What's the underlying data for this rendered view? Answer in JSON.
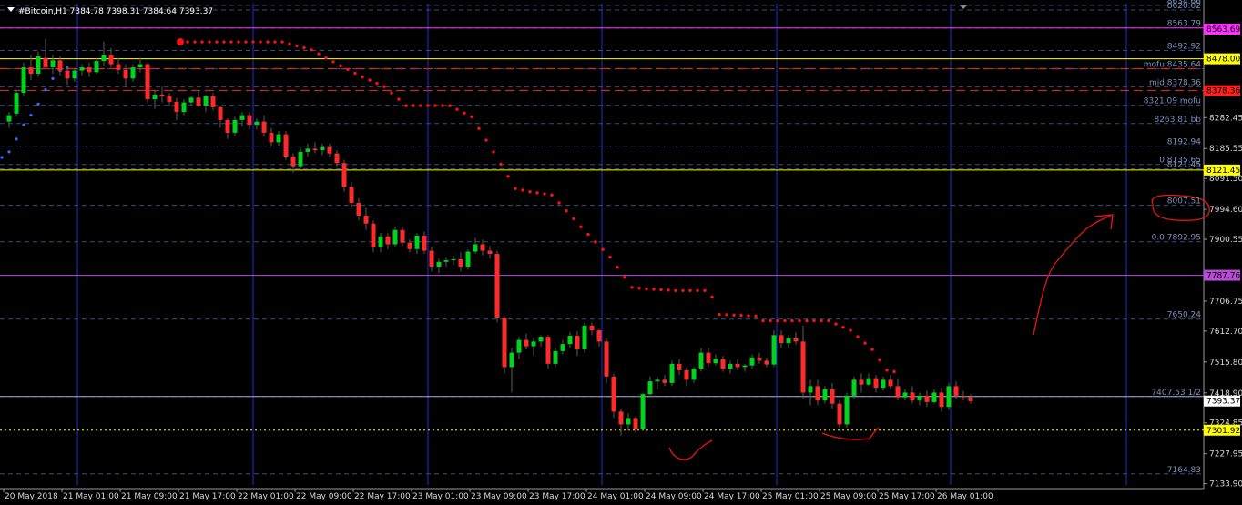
{
  "title": "#Bitcoin,H1  7384.78 7398.31 7384.64 7393.37",
  "colors": {
    "background": "#000000",
    "grid": "#2c3a66",
    "period_sep": "#1e2fd0",
    "bull": "#00d41c",
    "bear": "#ff2a2a",
    "wick": "#5c5c5c",
    "ma_red": "#ff1010",
    "ma_blue": "#3a6cff",
    "annot": "#e81515",
    "yellow": "#ffff00",
    "magenta": "#ff33ff",
    "violet": "#b84dd6",
    "level_text": "#7a8fb8",
    "tick_text": "#d8d8d8"
  },
  "chart_data": {
    "type": "candlestick",
    "symbol": "#Bitcoin",
    "timeframe": "H1",
    "last_bar": {
      "open": 7384.78,
      "high": 7398.31,
      "low": 7384.64,
      "close": 7393.37
    },
    "ylim": [
      7130,
      8640
    ],
    "y_ticks": [
      "8282.45",
      "8185.55",
      "8091.50",
      "7994.60",
      "7900.55",
      "7706.75",
      "7612.70",
      "7515.80",
      "7418.90",
      "7324.85",
      "7227.95",
      "7133.90"
    ],
    "x_labels": [
      "20 May 2018",
      "21 May 01:00",
      "21 May 09:00",
      "21 May 17:00",
      "22 May 01:00",
      "22 May 09:00",
      "22 May 17:00",
      "23 May 01:00",
      "23 May 09:00",
      "23 May 17:00",
      "24 May 01:00",
      "24 May 09:00",
      "24 May 17:00",
      "25 May 01:00",
      "25 May 09:00",
      "25 May 17:00",
      "26 May 01:00"
    ],
    "levels": [
      {
        "label": "8634.66",
        "value": 8634.66
      },
      {
        "label": "8620.02",
        "value": 8620.02
      },
      {
        "label": "8563.79",
        "value": 8563.79
      },
      {
        "label": "8492.92",
        "value": 8492.92
      },
      {
        "label": "mofu 8435.64",
        "value": 8435.64
      },
      {
        "label": "mid 8378.36",
        "value": 8378.36
      },
      {
        "label": "8321.09 mofu",
        "value": 8321.09
      },
      {
        "label": "8263.81  bb",
        "value": 8263.81
      },
      {
        "label": "8192.94",
        "value": 8192.94
      },
      {
        "label": "0 8135.65",
        "value": 8135.65
      },
      {
        "label": "8121.45",
        "value": 8121.45
      },
      {
        "label": "8007.51",
        "value": 8007.51
      },
      {
        "label": "0.0  7892.95",
        "value": 7892.95
      },
      {
        "label": "7650.24",
        "value": 7650.24
      },
      {
        "label": "7407.53 1/2",
        "value": 7407.53
      },
      {
        "label": "7164.83",
        "value": 7164.83
      }
    ],
    "price_boxes": [
      {
        "text": "8563.69",
        "value": 8560,
        "bg": "#ff33ff",
        "fg": "#000000"
      },
      {
        "text": "8478.00",
        "value": 8467,
        "bg": "#ffff00",
        "fg": "#000000"
      },
      {
        "text": "8378.36",
        "value": 8367,
        "bg": "#ff2222",
        "fg": "#000000"
      },
      {
        "text": "8121.45",
        "value": 8118,
        "bg": "#ffff00",
        "fg": "#000000"
      },
      {
        "text": "7787.76",
        "value": 7787.76,
        "bg": "#b84dd6",
        "fg": "#000000"
      },
      {
        "text": "7393.37",
        "value": 7393.37,
        "bg": "#ffffff",
        "fg": "#000000"
      },
      {
        "text": "7301.92",
        "value": 7301.92,
        "bg": "#ffff00",
        "fg": "#000000"
      }
    ],
    "hlines": [
      {
        "value": 8563.79,
        "color": "#ff33ff",
        "style": "solid"
      },
      {
        "value": 8467,
        "color": "#ffff00",
        "style": "solid"
      },
      {
        "value": 8435.64,
        "color": "#ff2222",
        "style": "dash"
      },
      {
        "value": 8367,
        "color": "#ff2222",
        "style": "dash"
      },
      {
        "value": 8118,
        "color": "#ffff00",
        "style": "solid"
      },
      {
        "value": 7787.76,
        "color": "#b84dd6",
        "style": "solid"
      },
      {
        "value": 7407.53,
        "color": "#9db0d8",
        "style": "solid"
      },
      {
        "value": 7301.92,
        "color": "#ffff00",
        "style": "dot"
      }
    ],
    "candles": [
      [
        8270,
        8300,
        8250,
        8290
      ],
      [
        8295,
        8370,
        8285,
        8360
      ],
      [
        8360,
        8455,
        8350,
        8440
      ],
      [
        8440,
        8480,
        8400,
        8420
      ],
      [
        8420,
        8490,
        8410,
        8475
      ],
      [
        8470,
        8530,
        8455,
        8440
      ],
      [
        8440,
        8480,
        8420,
        8462
      ],
      [
        8462,
        8475,
        8415,
        8430
      ],
      [
        8430,
        8445,
        8385,
        8405
      ],
      [
        8405,
        8440,
        8395,
        8430
      ],
      [
        8430,
        8450,
        8415,
        8440
      ],
      [
        8440,
        8455,
        8410,
        8425
      ],
      [
        8425,
        8470,
        8420,
        8460
      ],
      [
        8460,
        8520,
        8445,
        8480
      ],
      [
        8480,
        8500,
        8440,
        8450
      ],
      [
        8450,
        8470,
        8420,
        8432
      ],
      [
        8432,
        8450,
        8380,
        8405
      ],
      [
        8405,
        8450,
        8395,
        8440
      ],
      [
        8440,
        8470,
        8425,
        8450
      ],
      [
        8450,
        8455,
        8330,
        8340
      ],
      [
        8340,
        8370,
        8310,
        8355
      ],
      [
        8355,
        8380,
        8330,
        8350
      ],
      [
        8350,
        8360,
        8320,
        8332
      ],
      [
        8332,
        8345,
        8275,
        8300
      ],
      [
        8300,
        8340,
        8290,
        8330
      ],
      [
        8330,
        8350,
        8320,
        8345
      ],
      [
        8345,
        8370,
        8315,
        8320
      ],
      [
        8320,
        8355,
        8300,
        8350
      ],
      [
        8350,
        8360,
        8305,
        8315
      ],
      [
        8315,
        8320,
        8250,
        8275
      ],
      [
        8275,
        8280,
        8215,
        8235
      ],
      [
        8235,
        8285,
        8225,
        8275
      ],
      [
        8275,
        8300,
        8255,
        8290
      ],
      [
        8290,
        8300,
        8245,
        8260
      ],
      [
        8260,
        8280,
        8245,
        8270
      ],
      [
        8270,
        8290,
        8225,
        8235
      ],
      [
        8235,
        8250,
        8195,
        8205
      ],
      [
        8205,
        8240,
        8195,
        8230
      ],
      [
        8230,
        8240,
        8150,
        8160
      ],
      [
        8160,
        8170,
        8110,
        8130
      ],
      [
        8130,
        8190,
        8120,
        8175
      ],
      [
        8175,
        8200,
        8160,
        8185
      ],
      [
        8185,
        8205,
        8170,
        8180
      ],
      [
        8180,
        8200,
        8165,
        8190
      ],
      [
        8190,
        8200,
        8160,
        8170
      ],
      [
        8170,
        8180,
        8130,
        8140
      ],
      [
        8140,
        8150,
        8050,
        8065
      ],
      [
        8065,
        8080,
        8000,
        8015
      ],
      [
        8015,
        8030,
        7960,
        7975
      ],
      [
        7975,
        8000,
        7930,
        7950
      ],
      [
        7950,
        7960,
        7860,
        7875
      ],
      [
        7875,
        7920,
        7860,
        7910
      ],
      [
        7910,
        7920,
        7870,
        7885
      ],
      [
        7885,
        7940,
        7875,
        7930
      ],
      [
        7930,
        7940,
        7880,
        7890
      ],
      [
        7890,
        7900,
        7860,
        7870
      ],
      [
        7870,
        7920,
        7855,
        7912
      ],
      [
        7912,
        7925,
        7855,
        7865
      ],
      [
        7865,
        7875,
        7800,
        7815
      ],
      [
        7815,
        7840,
        7795,
        7830
      ],
      [
        7830,
        7845,
        7815,
        7835
      ],
      [
        7835,
        7850,
        7820,
        7838
      ],
      [
        7838,
        7860,
        7800,
        7815
      ],
      [
        7815,
        7870,
        7805,
        7862
      ],
      [
        7862,
        7905,
        7855,
        7885
      ],
      [
        7885,
        7900,
        7850,
        7865
      ],
      [
        7865,
        7880,
        7840,
        7855
      ],
      [
        7855,
        7865,
        7640,
        7655
      ],
      [
        7655,
        7660,
        7480,
        7500
      ],
      [
        7500,
        7560,
        7420,
        7545
      ],
      [
        7545,
        7595,
        7525,
        7585
      ],
      [
        7585,
        7605,
        7555,
        7565
      ],
      [
        7565,
        7590,
        7535,
        7580
      ],
      [
        7580,
        7600,
        7565,
        7595
      ],
      [
        7595,
        7600,
        7495,
        7510
      ],
      [
        7510,
        7560,
        7500,
        7550
      ],
      [
        7550,
        7585,
        7540,
        7572
      ],
      [
        7572,
        7610,
        7560,
        7598
      ],
      [
        7598,
        7612,
        7535,
        7555
      ],
      [
        7555,
        7640,
        7545,
        7630
      ],
      [
        7630,
        7640,
        7600,
        7615
      ],
      [
        7615,
        7620,
        7565,
        7580
      ],
      [
        7580,
        7590,
        7450,
        7470
      ],
      [
        7470,
        7480,
        7340,
        7360
      ],
      [
        7360,
        7370,
        7285,
        7320
      ],
      [
        7320,
        7355,
        7300,
        7340
      ],
      [
        7340,
        7345,
        7295,
        7305
      ],
      [
        7305,
        7420,
        7300,
        7415
      ],
      [
        7415,
        7470,
        7405,
        7455
      ],
      [
        7455,
        7470,
        7430,
        7460
      ],
      [
        7460,
        7475,
        7440,
        7450
      ],
      [
        7450,
        7520,
        7440,
        7510
      ],
      [
        7510,
        7525,
        7475,
        7490
      ],
      [
        7490,
        7500,
        7440,
        7460
      ],
      [
        7460,
        7500,
        7450,
        7495
      ],
      [
        7495,
        7560,
        7485,
        7545
      ],
      [
        7545,
        7560,
        7500,
        7512
      ],
      [
        7512,
        7540,
        7505,
        7525
      ],
      [
        7525,
        7535,
        7485,
        7495
      ],
      [
        7495,
        7520,
        7480,
        7510
      ],
      [
        7510,
        7525,
        7490,
        7500
      ],
      [
        7500,
        7510,
        7485,
        7505
      ],
      [
        7505,
        7540,
        7495,
        7530
      ],
      [
        7530,
        7545,
        7510,
        7520
      ],
      [
        7520,
        7530,
        7500,
        7508
      ],
      [
        7508,
        7615,
        7500,
        7600
      ],
      [
        7600,
        7615,
        7560,
        7575
      ],
      [
        7575,
        7600,
        7560,
        7590
      ],
      [
        7590,
        7610,
        7570,
        7580
      ],
      [
        7580,
        7630,
        7400,
        7420
      ],
      [
        7420,
        7460,
        7380,
        7440
      ],
      [
        7440,
        7460,
        7380,
        7395
      ],
      [
        7395,
        7440,
        7385,
        7430
      ],
      [
        7430,
        7450,
        7370,
        7385
      ],
      [
        7385,
        7395,
        7310,
        7320
      ],
      [
        7320,
        7420,
        7310,
        7410
      ],
      [
        7410,
        7470,
        7400,
        7460
      ],
      [
        7460,
        7480,
        7420,
        7445
      ],
      [
        7445,
        7480,
        7440,
        7465
      ],
      [
        7465,
        7475,
        7420,
        7435
      ],
      [
        7435,
        7470,
        7425,
        7460
      ],
      [
        7460,
        7475,
        7430,
        7440
      ],
      [
        7440,
        7465,
        7395,
        7405
      ],
      [
        7405,
        7430,
        7395,
        7420
      ],
      [
        7420,
        7440,
        7385,
        7395
      ],
      [
        7395,
        7420,
        7380,
        7410
      ],
      [
        7410,
        7425,
        7375,
        7390
      ],
      [
        7390,
        7430,
        7385,
        7420
      ],
      [
        7420,
        7435,
        7360,
        7375
      ],
      [
        7375,
        7450,
        7365,
        7440
      ],
      [
        7440,
        7455,
        7400,
        7410
      ],
      [
        7410,
        7425,
        7395,
        7405
      ],
      [
        7405,
        7415,
        7385,
        7393
      ]
    ],
    "ma_red": [
      [
        0,
        8520
      ],
      [
        14,
        8520
      ],
      [
        18,
        8495
      ],
      [
        22,
        8445
      ],
      [
        25,
        8410
      ],
      [
        28,
        8380
      ],
      [
        31,
        8320
      ],
      [
        37,
        8320
      ],
      [
        40,
        8285
      ],
      [
        43,
        8175
      ],
      [
        46,
        8060
      ],
      [
        48,
        8050
      ],
      [
        51,
        8040
      ],
      [
        55,
        7940
      ],
      [
        59,
        7845
      ],
      [
        62,
        7750
      ],
      [
        64,
        7745
      ],
      [
        68,
        7740
      ],
      [
        72,
        7740
      ],
      [
        73,
        7720
      ],
      [
        74,
        7665
      ],
      [
        79,
        7660
      ],
      [
        80,
        7645
      ],
      [
        89,
        7645
      ],
      [
        92,
        7615
      ],
      [
        95,
        7555
      ],
      [
        97,
        7490
      ],
      [
        98,
        7485
      ]
    ],
    "ma_blue": [
      [
        -9,
        8135
      ],
      [
        -6,
        8135
      ],
      [
        -3,
        8135
      ],
      [
        -2,
        8140
      ],
      [
        0,
        8175
      ],
      [
        1,
        8215
      ],
      [
        2,
        8260
      ],
      [
        3,
        8290
      ],
      [
        4,
        8325
      ],
      [
        5,
        8370
      ],
      [
        6,
        8405
      ],
      [
        7,
        8430
      ],
      [
        8,
        8440
      ]
    ]
  }
}
